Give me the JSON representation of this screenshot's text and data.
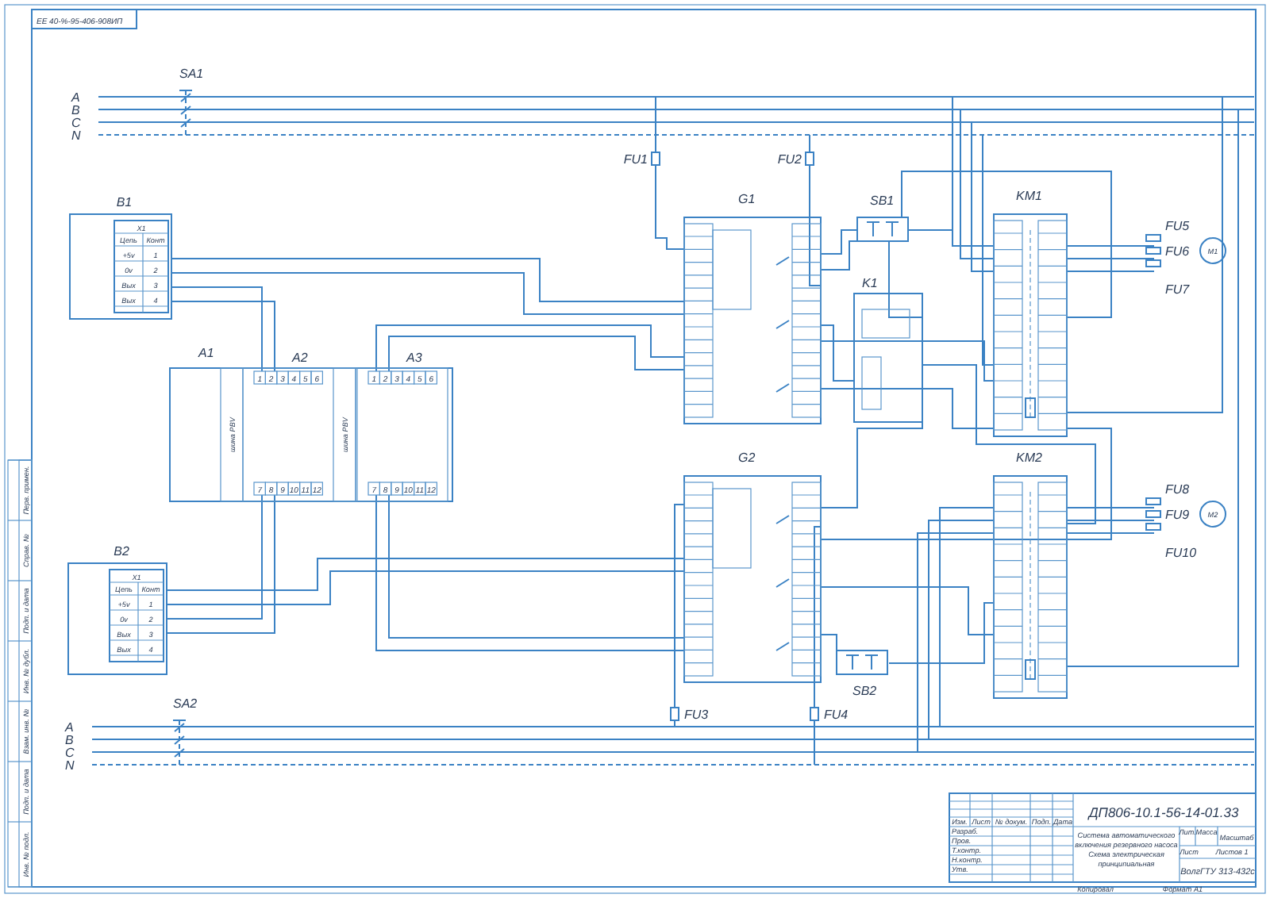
{
  "stamp": "ЕЕ 40-%-95-406-908ИП",
  "bus_top": {
    "switch": "SA1",
    "phases": [
      "A",
      "B",
      "C",
      "N"
    ]
  },
  "bus_bottom": {
    "switch": "SA2",
    "phases": [
      "A",
      "B",
      "C",
      "N"
    ]
  },
  "fuses": [
    {
      "label": "FU1"
    },
    {
      "label": "FU2"
    },
    {
      "label": "FU3"
    },
    {
      "label": "FU4"
    }
  ],
  "sensors": [
    {
      "label": "B1",
      "connector": "X1",
      "columns": [
        "Цепь",
        "Конт"
      ],
      "rows": [
        [
          "+5v",
          "1"
        ],
        [
          "0v",
          "2"
        ],
        [
          "Вых",
          "3"
        ],
        [
          "Вых",
          "4"
        ]
      ]
    },
    {
      "label": "B2",
      "connector": "X1",
      "columns": [
        "Цепь",
        "Конт"
      ],
      "rows": [
        [
          "+5v",
          "1"
        ],
        [
          "0v",
          "2"
        ],
        [
          "Вых",
          "3"
        ],
        [
          "Вых",
          "4"
        ]
      ]
    }
  ],
  "controller": {
    "label": "A1",
    "modules": [
      {
        "label": "A2",
        "caption": "шина PBV",
        "top_terminals": [
          "1",
          "2",
          "3",
          "4",
          "5",
          "6"
        ],
        "bottom_terminals": [
          "7",
          "8",
          "9",
          "10",
          "11",
          "12"
        ]
      },
      {
        "label": "A3",
        "caption": "шина PBV",
        "top_terminals": [
          "1",
          "2",
          "3",
          "4",
          "5",
          "6"
        ],
        "bottom_terminals": [
          "7",
          "8",
          "9",
          "10",
          "11",
          "12"
        ]
      }
    ]
  },
  "relay_modules": [
    {
      "label": "G1"
    },
    {
      "label": "G2"
    }
  ],
  "push_buttons": [
    {
      "label": "SB1"
    },
    {
      "label": "SB2"
    }
  ],
  "relay": {
    "label": "K1"
  },
  "contactors": [
    {
      "label": "KM1",
      "fuses": [
        "FU5",
        "FU6",
        "FU7"
      ],
      "motor": "M1"
    },
    {
      "label": "KM2",
      "fuses": [
        "FU8",
        "FU9",
        "FU10"
      ],
      "motor": "M2"
    }
  ],
  "margin_cells": [
    "Перв. примен.",
    "Справ. №",
    "Подп. и дата",
    "Инв. № дубл.",
    "Взам. инв. №",
    "Подп. и дата",
    "Инв. № подл."
  ],
  "title_block": {
    "designation": "ДП806-10.1-56-14-01.33",
    "title_lines": [
      "Система автоматического",
      "включения резервного насоса",
      "Схема электрическая",
      "принципиальная"
    ],
    "organization": "ВолгГТУ 313-432с",
    "headers": [
      "Изм.",
      "Лист",
      "№ докум.",
      "Подп.",
      "Дата"
    ],
    "roles": [
      "Разраб.",
      "Пров.",
      "Т.контр.",
      "Н.контр.",
      "Утв."
    ],
    "cells": [
      "Лит.",
      "Масса",
      "Масштаб",
      "Лист",
      "Листов 1"
    ]
  },
  "footer": [
    "Копировал",
    "Формат A1"
  ]
}
